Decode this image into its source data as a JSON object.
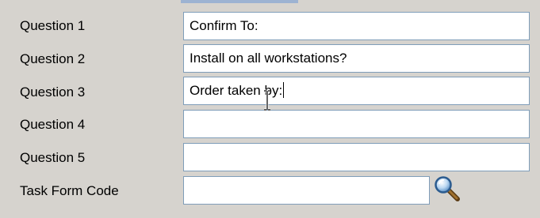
{
  "form": {
    "rows": [
      {
        "label": "Question 1",
        "value": "Confirm To:"
      },
      {
        "label": "Question 2",
        "value": "Install on all workstations?"
      },
      {
        "label": "Question 3",
        "value": "Order taken by:"
      },
      {
        "label": "Question 4",
        "value": ""
      },
      {
        "label": "Question 5",
        "value": ""
      }
    ],
    "task_form_code": {
      "label": "Task Form Code",
      "value": ""
    }
  },
  "icons": {
    "lookup": "magnifier-icon",
    "cursor": "text-cursor-icon"
  },
  "colors": {
    "background": "#d6d3ce",
    "field_border": "#7f9db9",
    "field_bg": "#ffffff"
  }
}
